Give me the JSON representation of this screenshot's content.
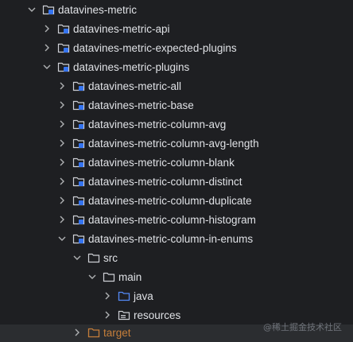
{
  "tree": {
    "items": [
      {
        "label": "datavines-metric",
        "expanded": true,
        "icon": "module-folder-icon"
      },
      {
        "label": "datavines-metric-api",
        "expanded": false,
        "icon": "module-folder-icon"
      },
      {
        "label": "datavines-metric-expected-plugins",
        "expanded": false,
        "icon": "module-folder-icon"
      },
      {
        "label": "datavines-metric-plugins",
        "expanded": true,
        "icon": "module-folder-icon"
      },
      {
        "label": "datavines-metric-all",
        "expanded": false,
        "icon": "module-folder-icon"
      },
      {
        "label": "datavines-metric-base",
        "expanded": false,
        "icon": "module-folder-icon"
      },
      {
        "label": "datavines-metric-column-avg",
        "expanded": false,
        "icon": "module-folder-icon"
      },
      {
        "label": "datavines-metric-column-avg-length",
        "expanded": false,
        "icon": "module-folder-icon"
      },
      {
        "label": "datavines-metric-column-blank",
        "expanded": false,
        "icon": "module-folder-icon"
      },
      {
        "label": "datavines-metric-column-distinct",
        "expanded": false,
        "icon": "module-folder-icon"
      },
      {
        "label": "datavines-metric-column-duplicate",
        "expanded": false,
        "icon": "module-folder-icon"
      },
      {
        "label": "datavines-metric-column-histogram",
        "expanded": false,
        "icon": "module-folder-icon"
      },
      {
        "label": "datavines-metric-column-in-enums",
        "expanded": true,
        "icon": "module-folder-icon"
      },
      {
        "label": "src",
        "expanded": true,
        "icon": "folder-icon"
      },
      {
        "label": "main",
        "expanded": true,
        "icon": "folder-icon"
      },
      {
        "label": "java",
        "expanded": false,
        "icon": "source-folder-icon"
      },
      {
        "label": "resources",
        "expanded": false,
        "icon": "resources-folder-icon"
      },
      {
        "label": "target",
        "expanded": false,
        "icon": "excluded-folder-icon"
      }
    ]
  },
  "colors": {
    "background": "#1e1f22",
    "text": "#dfe1e5",
    "excluded_text": "#c57e3a",
    "module_badge": "#3574f0"
  },
  "watermark": "@稀土掘金技术社区"
}
